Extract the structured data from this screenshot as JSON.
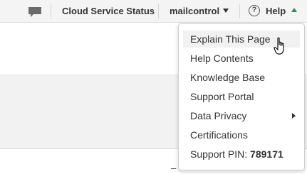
{
  "topbar": {
    "chat_icon": "chat-bubble-icon",
    "cloud_status_label": "Cloud Service Status",
    "account_label": "mailcontrol",
    "help_label": "Help",
    "help_icon_glyph": "?"
  },
  "help_menu": {
    "items": [
      {
        "label": "Explain This Page",
        "hovered": true
      },
      {
        "label": "Help Contents"
      },
      {
        "label": "Knowledge Base"
      },
      {
        "label": "Support Portal"
      },
      {
        "label": "Data Privacy",
        "has_submenu": true
      },
      {
        "label": "Certifications"
      }
    ],
    "support_pin_label": "Support PIN:",
    "support_pin_value": "789171"
  },
  "colors": {
    "accent_green": "#2c8c5a",
    "topbar_bg": "#f4f4f4",
    "band_bg": "#f2f2f2"
  }
}
